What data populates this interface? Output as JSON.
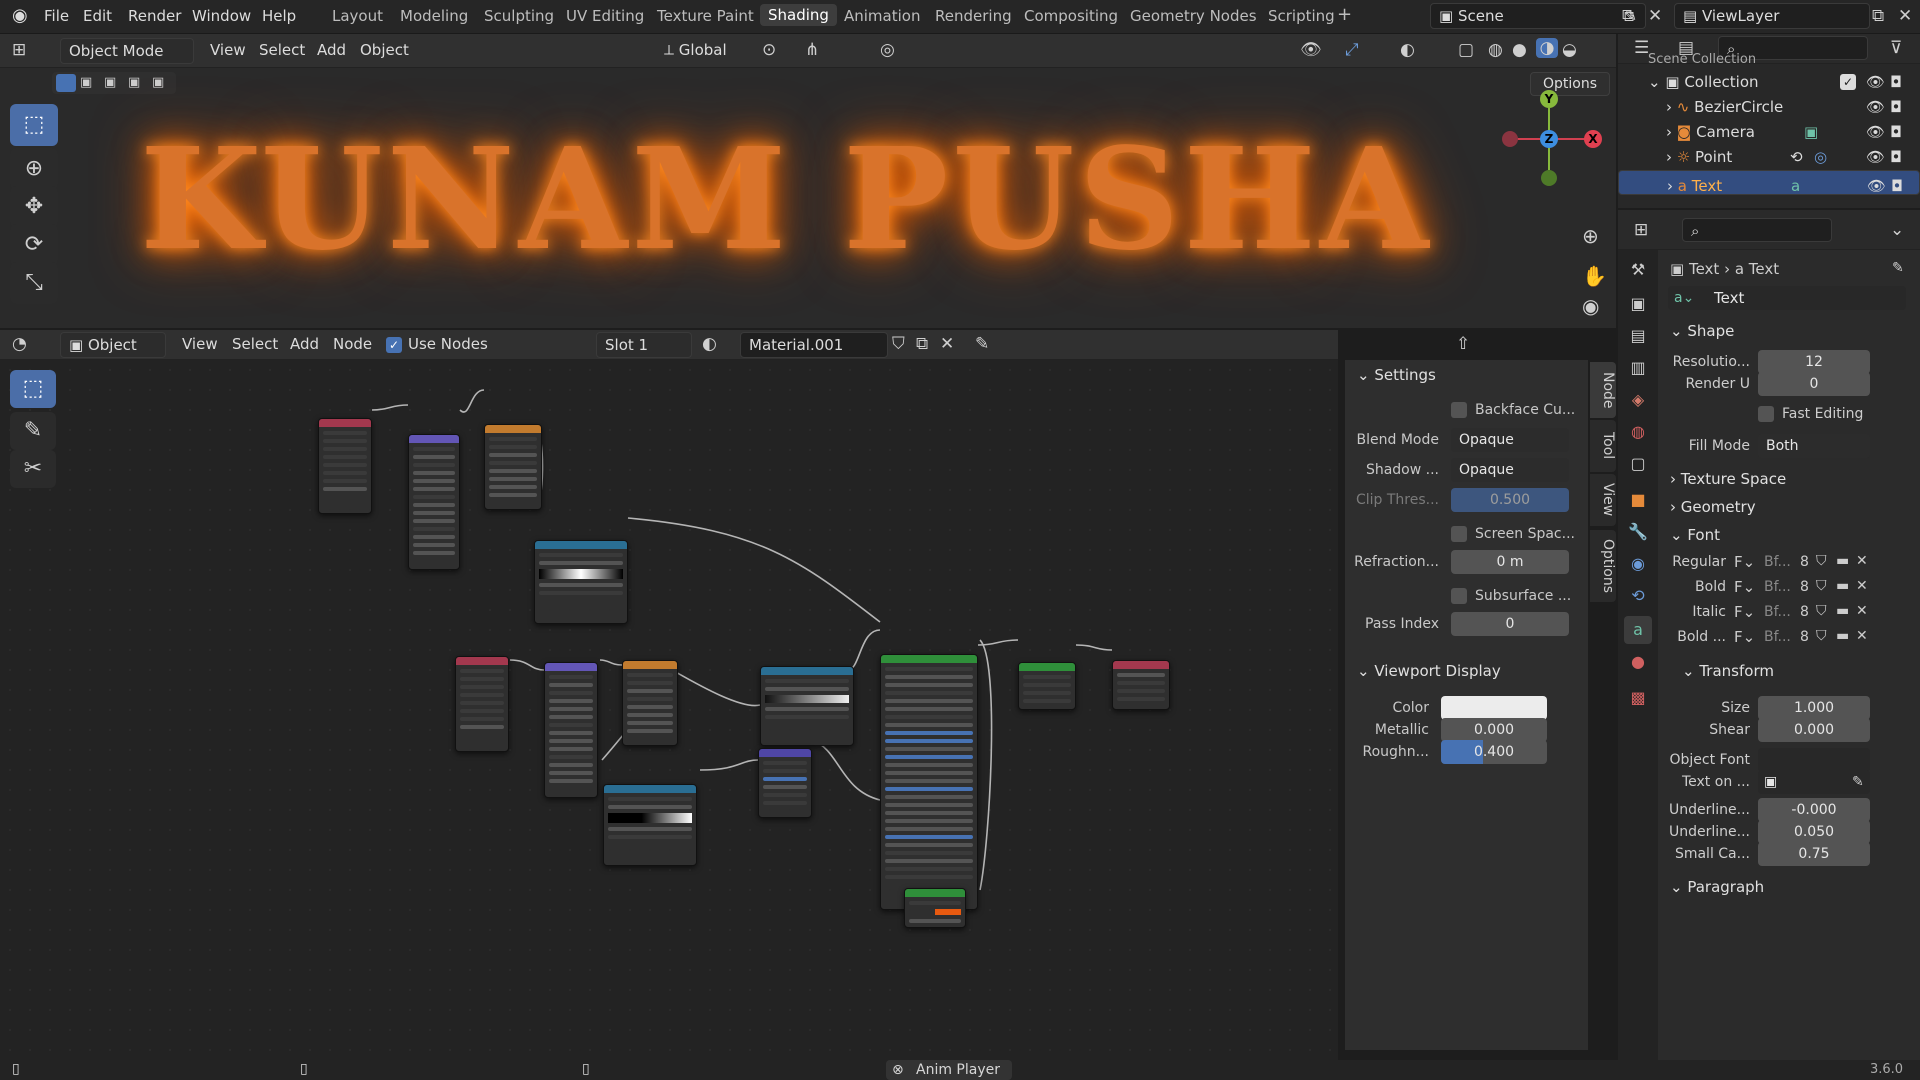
{
  "menus": [
    "File",
    "Edit",
    "Render",
    "Window",
    "Help"
  ],
  "workspaces": [
    "Layout",
    "Modeling",
    "Sculpting",
    "UV Editing",
    "Texture Paint",
    "Shading",
    "Animation",
    "Rendering",
    "Compositing",
    "Geometry Nodes",
    "Scripting"
  ],
  "active_workspace": "Shading",
  "scene": "Scene",
  "view_layer": "ViewLayer",
  "viewport": {
    "mode": "Object Mode",
    "menus": [
      "View",
      "Select",
      "Add",
      "Object"
    ],
    "orientation": "Global",
    "options": "Options",
    "render_text": "KUNAM PUSHA",
    "gizmo": {
      "y": "Y",
      "z": "Z",
      "x": "X"
    }
  },
  "node_editor": {
    "type": "Object",
    "menus": [
      "View",
      "Select",
      "Add",
      "Node"
    ],
    "use_nodes": "Use Nodes",
    "slot": "Slot 1",
    "material": "Material.001"
  },
  "node_sidebar": {
    "tabs": [
      "Node",
      "Tool",
      "View",
      "Options"
    ],
    "settings_title": "Settings",
    "backface": "Backface Cu...",
    "blend_mode_label": "Blend Mode",
    "blend_mode": "Opaque",
    "shadow_label": "Shadow ...",
    "shadow": "Opaque",
    "clip_label": "Clip Thres...",
    "clip": "0.500",
    "screen_space": "Screen Spac...",
    "refraction_label": "Refraction...",
    "refraction": "0 m",
    "subsurface": "Subsurface ...",
    "pass_index_label": "Pass Index",
    "pass_index": "0",
    "viewport_display": "Viewport Display",
    "color_label": "Color",
    "metallic_label": "Metallic",
    "metallic": "0.000",
    "roughness_label": "Roughn...",
    "roughness": "0.400",
    "roughness_value": 0.4
  },
  "outliner": {
    "scene_collection": "Scene Collection",
    "collection": "Collection",
    "items": [
      "BezierCircle",
      "Camera",
      "Point",
      "Text"
    ]
  },
  "properties": {
    "breadcrumb": [
      "Text",
      "Text"
    ],
    "datablock": "Text",
    "shape": "Shape",
    "resolution_label": "Resolutio...",
    "resolution": "12",
    "render_u_label": "Render U",
    "render_u": "0",
    "fast_editing": "Fast Editing",
    "fill_mode_label": "Fill Mode",
    "fill_mode": "Both",
    "texture_space": "Texture Space",
    "geometry": "Geometry",
    "font": "Font",
    "font_rows": [
      {
        "label": "Regular",
        "name": "Bf...",
        "users": "8"
      },
      {
        "label": "Bold",
        "name": "Bf...",
        "users": "8"
      },
      {
        "label": "Italic",
        "name": "Bf...",
        "users": "8"
      },
      {
        "label": "Bold ...",
        "name": "Bf...",
        "users": "8"
      }
    ],
    "transform": "Transform",
    "size_label": "Size",
    "size": "1.000",
    "shear_label": "Shear",
    "shear": "0.000",
    "object_font": "Object Font",
    "text_on": "Text on ...",
    "underline_pos_label": "Underline...",
    "underline_pos": "-0.000",
    "underline_th_label": "Underline...",
    "underline_th": "0.050",
    "small_caps_label": "Small Ca...",
    "small_caps": "0.75",
    "paragraph": "Paragraph"
  },
  "status": {
    "anim_player": "Anim Player",
    "version": "3.6.0"
  },
  "colors": {
    "accent": "#4772b3",
    "glow": "#ff8a20",
    "selection": "#334d80"
  }
}
